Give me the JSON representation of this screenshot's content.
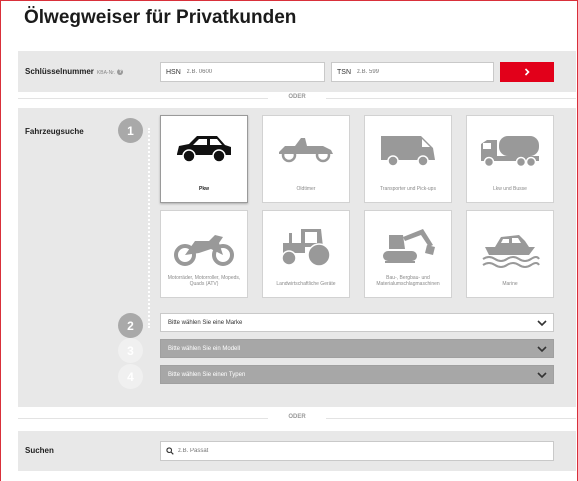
{
  "page": {
    "title": "Ölwegweiser für Privatkunden"
  },
  "key_search": {
    "label": "Schlüsselnummer",
    "sub_label": "KBA-Nr.",
    "info_icon": "?",
    "hsn_prefix": "HSN",
    "hsn_placeholder": "z.B. 0600",
    "tsn_prefix": "TSN",
    "tsn_placeholder": "z.B. 599",
    "submit_icon": "chevron-right-icon"
  },
  "dividers": {
    "first": "ODER",
    "second": "ODER"
  },
  "vehicle_search": {
    "label": "Fahrzeugsuche",
    "steps": [
      "1",
      "2",
      "3",
      "4"
    ],
    "categories": [
      {
        "label": "Pkw",
        "icon": "car-icon",
        "active": true
      },
      {
        "label": "Oldtimer",
        "icon": "vintage-car-icon",
        "active": false
      },
      {
        "label": "Transporter und Pick-ups",
        "icon": "van-icon",
        "active": false
      },
      {
        "label": "Lkw und Busse",
        "icon": "truck-icon",
        "active": false
      },
      {
        "label": "Motorräder, Motorroller, Mopeds, Quads (ATV)",
        "icon": "motorcycle-icon",
        "active": false
      },
      {
        "label": "Landwirtschaftliche Geräte",
        "icon": "tractor-icon",
        "active": false
      },
      {
        "label": "Bau-, Bergbau- und Materialumschlagmaschinen",
        "icon": "excavator-icon",
        "active": false
      },
      {
        "label": "Marine",
        "icon": "boat-icon",
        "active": false
      }
    ],
    "selects": {
      "brand": "Bitte wählen Sie eine Marke",
      "model": "Bitte wählen Sie ein Modell",
      "type": "Bitte wählen Sie einen Typen"
    }
  },
  "free_search": {
    "label": "Suchen",
    "placeholder": "z.B. Passat"
  },
  "colors": {
    "accent": "#e2001a",
    "panel": "#e8e8e8",
    "step": "#a9a9a9"
  }
}
